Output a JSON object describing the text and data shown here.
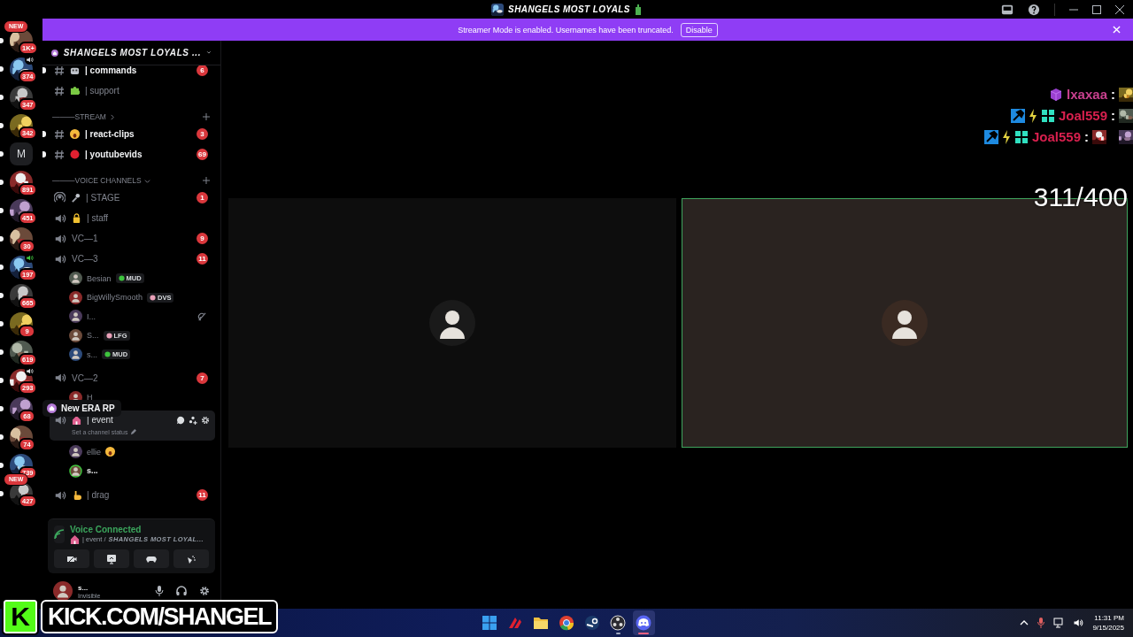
{
  "window": {
    "title": "SHANGELS MOST LOYALS"
  },
  "banner": {
    "text": "Streamer Mode is enabled. Usernames have been truncated.",
    "button": "Disable"
  },
  "servers": [
    {
      "kind": "picture",
      "label": "NEW",
      "badge": "1K+",
      "unread": true
    },
    {
      "kind": "picture",
      "badge": "374",
      "voice": true,
      "voice_active": false,
      "unread": true
    },
    {
      "kind": "picture",
      "badge": "347",
      "unread": true
    },
    {
      "kind": "picture",
      "badge": "342",
      "unread": true
    },
    {
      "kind": "letter",
      "letter": "M",
      "unread": true
    },
    {
      "kind": "picture",
      "badge": "891",
      "unread": true
    },
    {
      "kind": "picture",
      "badge": "451",
      "unread": true
    },
    {
      "kind": "picture",
      "badge": "30",
      "unread": true
    },
    {
      "kind": "picture",
      "badge": "197",
      "voice": true,
      "voice_active": true,
      "unread": true
    },
    {
      "kind": "picture",
      "badge": "665",
      "unread": true
    },
    {
      "kind": "picture",
      "badge": "9",
      "unread": true
    },
    {
      "kind": "picture",
      "badge": "619",
      "unread": true
    },
    {
      "kind": "picture",
      "badge": "293",
      "voice": true,
      "voice_active": false,
      "unread": true
    },
    {
      "kind": "picture",
      "badge": "68",
      "unread": true
    },
    {
      "kind": "picture",
      "badge": "74",
      "unread": true
    },
    {
      "kind": "picture",
      "badge": "739",
      "unread": true
    },
    {
      "kind": "picture",
      "label": "NEW",
      "badge": "427",
      "unread": true
    }
  ],
  "tooltip": {
    "text": "New ERA RP"
  },
  "sidebar": {
    "server_name": "SHANGELS MOST LOYALS ...",
    "channels": [
      {
        "kind": "text",
        "name": "| commands",
        "badge": "6",
        "unread": true
      },
      {
        "kind": "text",
        "name": "| support",
        "unread": false
      },
      {
        "kind": "category",
        "name": "———STREAM",
        "collapsed": true
      },
      {
        "kind": "text",
        "name": "| react-clips",
        "badge": "3",
        "unread": true
      },
      {
        "kind": "text",
        "name": "| youtubevids",
        "badge": "69",
        "unread": true
      },
      {
        "kind": "category",
        "name": "———VOICE CHANNELS",
        "collapsed": false
      },
      {
        "kind": "stage",
        "name": "| STAGE",
        "badge": "1"
      },
      {
        "kind": "voice",
        "name": "| staff"
      },
      {
        "kind": "voice",
        "name": "VC—1",
        "badge": "9"
      },
      {
        "kind": "voice",
        "name": "VC—3",
        "badge": "11",
        "members": [
          {
            "name": "Besian",
            "tag": {
              "text": "MUD",
              "color": "#3ec43e"
            },
            "speaking": false,
            "deafened": false
          },
          {
            "name": "BigWillySmooth",
            "tag": {
              "text": "DVS",
              "color": "#e8a0b8"
            },
            "speaking": false,
            "deafened": false
          },
          {
            "name": "I...",
            "speaking": false,
            "deafened": true
          },
          {
            "name": "S...",
            "tag": {
              "text": "LFG",
              "color": "#e8a0b8"
            },
            "speaking": false,
            "deafened": false
          },
          {
            "name": "s...",
            "tag": {
              "text": "MUD",
              "color": "#3ec43e"
            },
            "speaking": false,
            "deafened": false
          }
        ]
      },
      {
        "kind": "voice",
        "name": "VC—2",
        "badge": "7",
        "members": [
          {
            "name": "H",
            "speaking": false,
            "deafened": false
          }
        ]
      },
      {
        "kind": "voice",
        "name": "| event",
        "hovered": true,
        "status_placeholder": "Set a channel status",
        "members": [
          {
            "name": "ellie",
            "speaking": false,
            "deafened": false
          },
          {
            "name": "s...",
            "speaking": true,
            "deafened": false
          }
        ]
      },
      {
        "kind": "voice",
        "name": "| drag",
        "badge": "11"
      }
    ],
    "voice_panel": {
      "status": "Voice Connected",
      "location": "| event /",
      "server": "SHANGELS MOST LOYAL..."
    },
    "user": {
      "name": "s...",
      "status": "Invisible"
    }
  },
  "stage": {
    "tiles": [
      {
        "kind": "picture",
        "speaking": false
      },
      {
        "kind": "picture",
        "speaking": true
      }
    ],
    "chat": [
      {
        "user": "lxaxaa",
        "kind": "viewer",
        "color": "#c8408e",
        "separator": ":",
        "emotes": [
          {
            "kind": "picture"
          }
        ]
      },
      {
        "user": "Joal559",
        "kind": "moderator",
        "color": "#d8204e",
        "separator": ":",
        "emotes": [
          {
            "kind": "picture"
          }
        ]
      },
      {
        "user": "Joal559",
        "kind": "moderator",
        "color": "#d8204e",
        "separator": ":",
        "emotes": [
          {
            "kind": "picture"
          },
          {
            "kind": "picture"
          }
        ]
      }
    ],
    "counter": "311/400"
  },
  "stream_overlay": {
    "logo": "K",
    "text": "KICK.COM/SHANGEL"
  },
  "taskbar": {
    "apps": [
      {
        "running": false,
        "selected": false
      },
      {
        "running": false,
        "selected": false
      },
      {
        "running": false,
        "selected": false
      },
      {
        "running": false,
        "selected": false
      },
      {
        "running": false,
        "selected": false
      },
      {
        "running": true,
        "selected": false
      },
      {
        "running": true,
        "selected": true
      }
    ],
    "time": "11:31 PM",
    "date": "9/15/2025"
  }
}
